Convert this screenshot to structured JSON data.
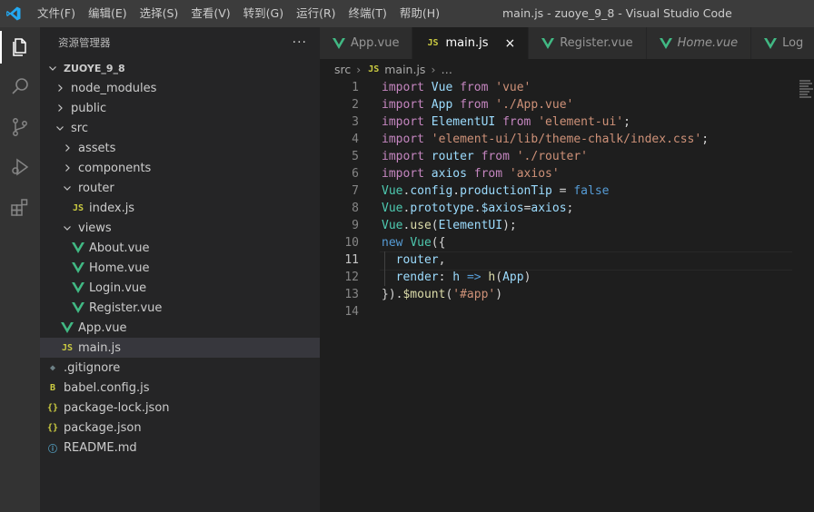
{
  "titlebar": {
    "menu": [
      "文件(F)",
      "编辑(E)",
      "选择(S)",
      "查看(V)",
      "转到(G)",
      "运行(R)",
      "终端(T)",
      "帮助(H)"
    ],
    "window_title": "main.js - zuoye_9_8 - Visual Studio Code"
  },
  "activity_icons": [
    "files-icon",
    "search-icon",
    "source-control-icon",
    "run-debug-icon",
    "extensions-icon"
  ],
  "sidebar": {
    "title": "资源管理器",
    "more": "···",
    "project": "ZUOYE_9_8",
    "items": [
      {
        "label": "node_modules",
        "type": "folder",
        "open": false
      },
      {
        "label": "public",
        "type": "folder",
        "open": false
      },
      {
        "label": "src",
        "type": "folder",
        "open": true
      },
      {
        "label": "assets",
        "type": "folder",
        "open": false
      },
      {
        "label": "components",
        "type": "folder",
        "open": false
      },
      {
        "label": "router",
        "type": "folder",
        "open": true
      },
      {
        "label": "index.js",
        "type": "js"
      },
      {
        "label": "views",
        "type": "folder",
        "open": true
      },
      {
        "label": "About.vue",
        "type": "vue"
      },
      {
        "label": "Home.vue",
        "type": "vue"
      },
      {
        "label": "Login.vue",
        "type": "vue"
      },
      {
        "label": "Register.vue",
        "type": "vue"
      },
      {
        "label": "App.vue",
        "type": "vue"
      },
      {
        "label": "main.js",
        "type": "js",
        "selected": true
      },
      {
        "label": ".gitignore",
        "type": "git"
      },
      {
        "label": "babel.config.js",
        "type": "babel"
      },
      {
        "label": "package-lock.json",
        "type": "json"
      },
      {
        "label": "package.json",
        "type": "json"
      },
      {
        "label": "README.md",
        "type": "info"
      }
    ]
  },
  "tabs": [
    {
      "label": "App.vue",
      "type": "vue"
    },
    {
      "label": "main.js",
      "type": "js",
      "active": true,
      "close": "×"
    },
    {
      "label": "Register.vue",
      "type": "vue"
    },
    {
      "label": "Home.vue",
      "type": "vue",
      "italic": true
    },
    {
      "label": "Log",
      "type": "vue"
    }
  ],
  "breadcrumb": {
    "folder": "src",
    "file": "main.js",
    "more": "…",
    "sep": "›"
  },
  "file_icon_text": {
    "js": "JS",
    "json": "{}",
    "info": "ⓘ",
    "babel": "B",
    "git": "◆"
  },
  "editor": {
    "current_line": 11,
    "lines": [
      {
        "n": "1",
        "tokens": [
          [
            "kw",
            "import"
          ],
          [
            "plain",
            " "
          ],
          [
            "var",
            "Vue"
          ],
          [
            "plain",
            " "
          ],
          [
            "kw",
            "from"
          ],
          [
            "plain",
            " "
          ],
          [
            "str",
            "'vue'"
          ]
        ]
      },
      {
        "n": "2",
        "tokens": [
          [
            "kw",
            "import"
          ],
          [
            "plain",
            " "
          ],
          [
            "var",
            "App"
          ],
          [
            "plain",
            " "
          ],
          [
            "kw",
            "from"
          ],
          [
            "plain",
            " "
          ],
          [
            "str",
            "'./App.vue'"
          ]
        ]
      },
      {
        "n": "3",
        "tokens": [
          [
            "kw",
            "import"
          ],
          [
            "plain",
            " "
          ],
          [
            "var",
            "ElementUI"
          ],
          [
            "plain",
            " "
          ],
          [
            "kw",
            "from"
          ],
          [
            "plain",
            " "
          ],
          [
            "str",
            "'element-ui'"
          ],
          [
            "plain",
            ";"
          ]
        ]
      },
      {
        "n": "4",
        "tokens": [
          [
            "kw",
            "import"
          ],
          [
            "plain",
            " "
          ],
          [
            "str",
            "'element-ui/lib/theme-chalk/index.css'"
          ],
          [
            "plain",
            ";"
          ]
        ]
      },
      {
        "n": "5",
        "tokens": [
          [
            "kw",
            "import"
          ],
          [
            "plain",
            " "
          ],
          [
            "var",
            "router"
          ],
          [
            "plain",
            " "
          ],
          [
            "kw",
            "from"
          ],
          [
            "plain",
            " "
          ],
          [
            "str",
            "'./router'"
          ]
        ]
      },
      {
        "n": "6",
        "tokens": [
          [
            "kw",
            "import"
          ],
          [
            "plain",
            " "
          ],
          [
            "var",
            "axios"
          ],
          [
            "plain",
            " "
          ],
          [
            "kw",
            "from"
          ],
          [
            "plain",
            " "
          ],
          [
            "str",
            "'axios'"
          ]
        ]
      },
      {
        "n": "7",
        "tokens": [
          [
            "cls",
            "Vue"
          ],
          [
            "plain",
            "."
          ],
          [
            "var",
            "config"
          ],
          [
            "plain",
            "."
          ],
          [
            "var",
            "productionTip"
          ],
          [
            "plain",
            " = "
          ],
          [
            "kb",
            "false"
          ]
        ]
      },
      {
        "n": "8",
        "tokens": [
          [
            "cls",
            "Vue"
          ],
          [
            "plain",
            "."
          ],
          [
            "var",
            "prototype"
          ],
          [
            "plain",
            "."
          ],
          [
            "var",
            "$axios"
          ],
          [
            "plain",
            "="
          ],
          [
            "var",
            "axios"
          ],
          [
            "plain",
            ";"
          ]
        ]
      },
      {
        "n": "9",
        "tokens": [
          [
            "cls",
            "Vue"
          ],
          [
            "plain",
            "."
          ],
          [
            "fn",
            "use"
          ],
          [
            "plain",
            "("
          ],
          [
            "var",
            "ElementUI"
          ],
          [
            "plain",
            ");"
          ]
        ]
      },
      {
        "n": "10",
        "tokens": [
          [
            "kb",
            "new"
          ],
          [
            "plain",
            " "
          ],
          [
            "cls",
            "Vue"
          ],
          [
            "plain",
            "({"
          ]
        ]
      },
      {
        "n": "11",
        "tokens": [
          [
            "plain",
            "  "
          ],
          [
            "var",
            "router"
          ],
          [
            "plain",
            ","
          ]
        ]
      },
      {
        "n": "12",
        "tokens": [
          [
            "plain",
            "  "
          ],
          [
            "var",
            "render"
          ],
          [
            "plain",
            ": "
          ],
          [
            "var",
            "h"
          ],
          [
            "plain",
            " "
          ],
          [
            "kb",
            "=>"
          ],
          [
            "plain",
            " "
          ],
          [
            "fn",
            "h"
          ],
          [
            "plain",
            "("
          ],
          [
            "var",
            "App"
          ],
          [
            "plain",
            ")"
          ]
        ]
      },
      {
        "n": "13",
        "tokens": [
          [
            "plain",
            "})."
          ],
          [
            "fn",
            "$mount"
          ],
          [
            "plain",
            "("
          ],
          [
            "str",
            "'#app'"
          ],
          [
            "plain",
            ")"
          ]
        ]
      },
      {
        "n": "14",
        "tokens": []
      }
    ]
  }
}
